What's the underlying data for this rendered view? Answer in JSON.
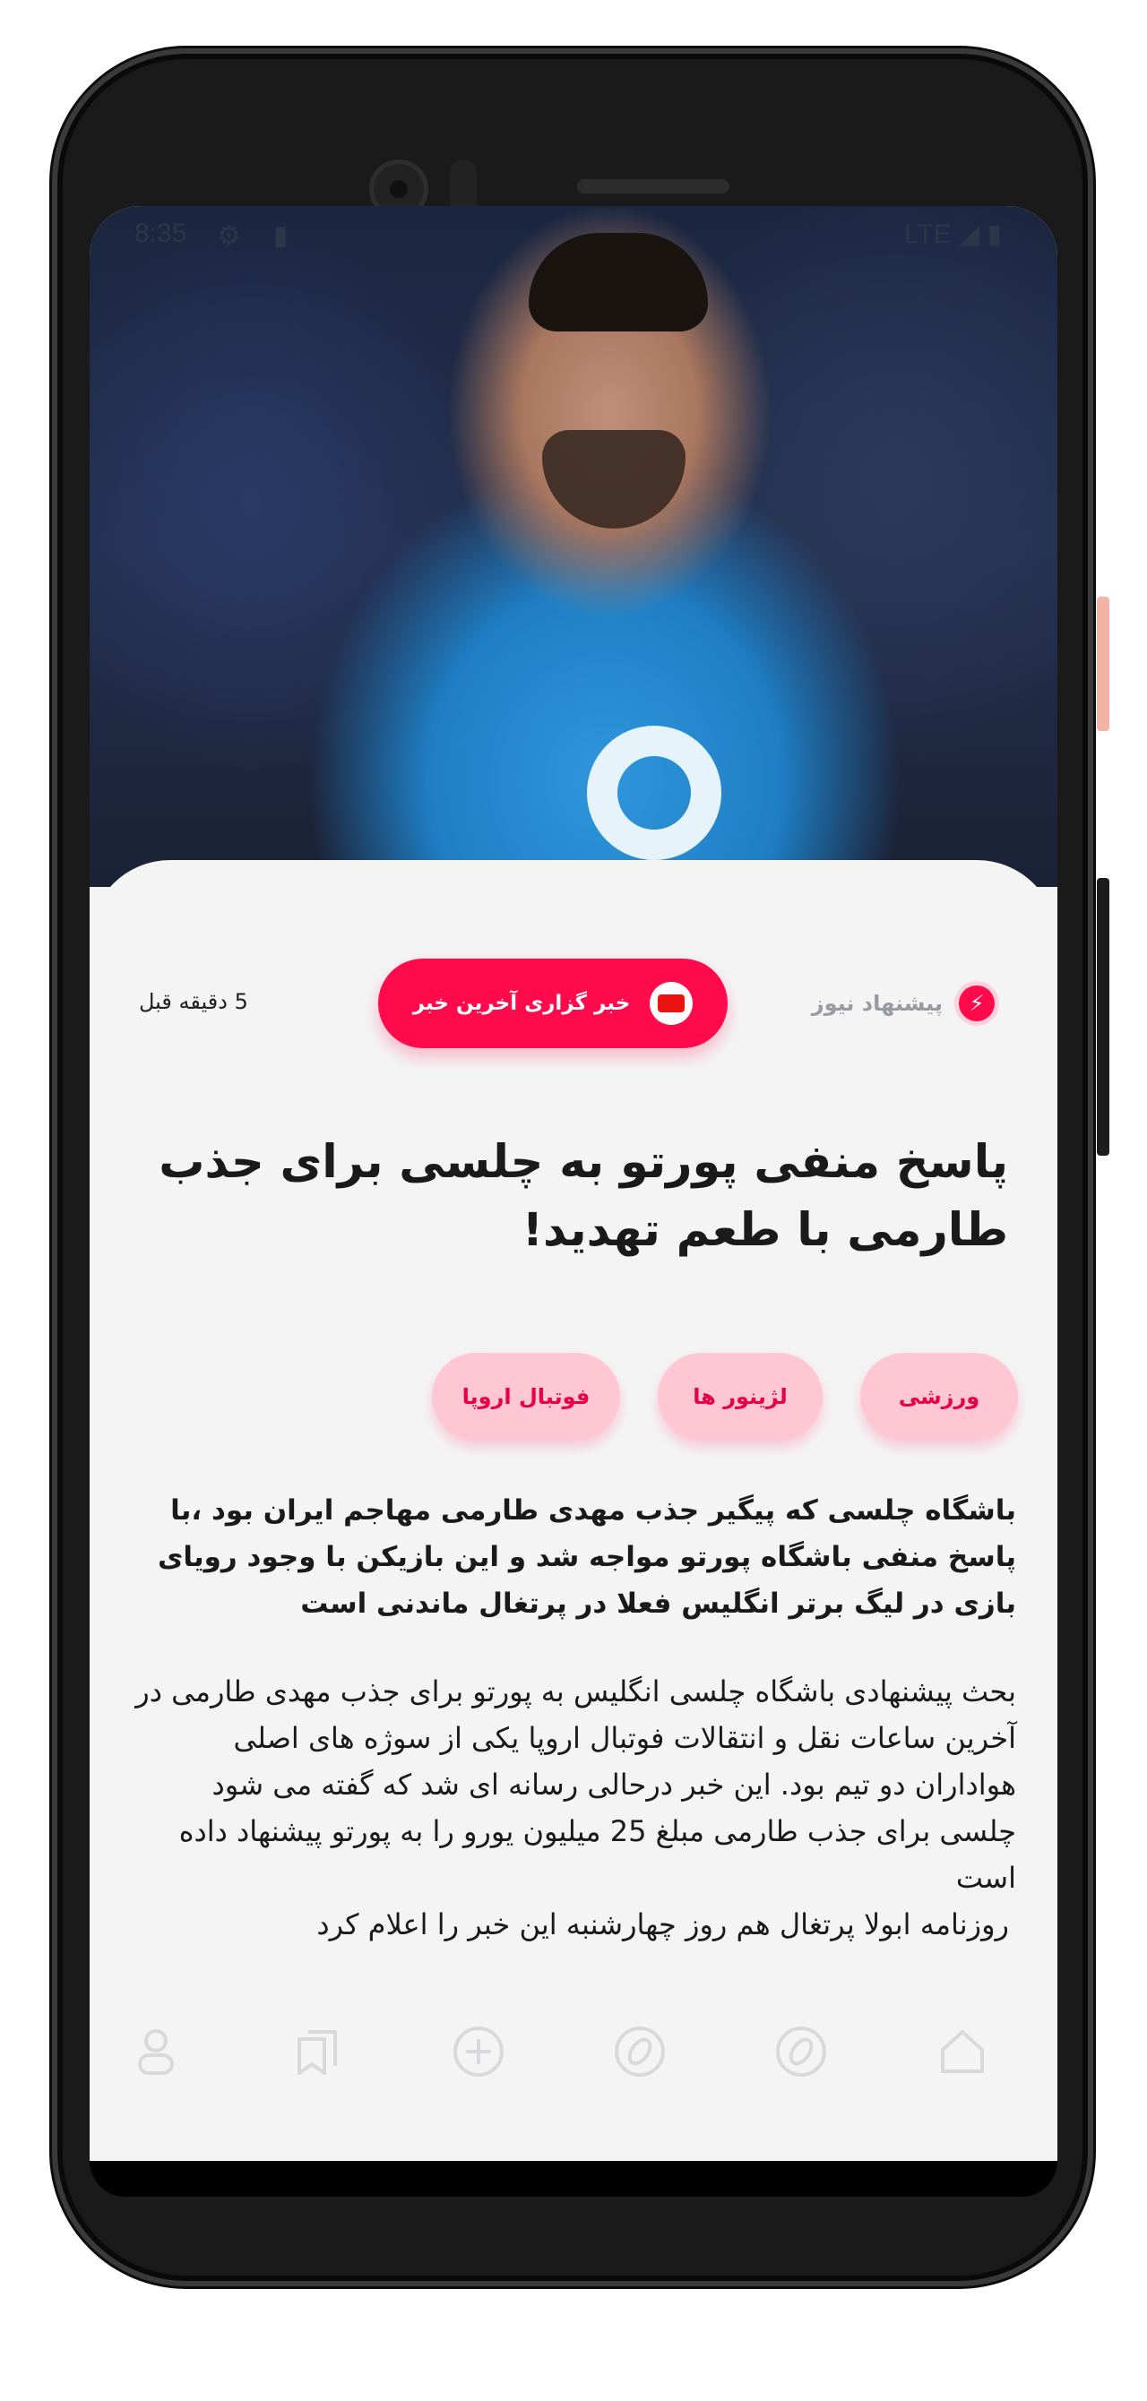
{
  "status_bar": {
    "time": "8:35",
    "network": "LTE"
  },
  "article": {
    "source_suggest_label": "پیشنهاد نیوز",
    "agency_name": "خبر گزاری آخرین خبر",
    "time_ago": "5 دقیقه قبل",
    "title": "پاسخ منفی پورتو به چلسی برای جذب طارمی با طعم تهدید!",
    "tags": [
      "ورزشی",
      "لژینور ها",
      "فوتبال اروپا"
    ],
    "lead": "باشگاه چلسی که پیگیر جذب مهدی طارمی مهاجم ایران بود ،با پاسخ منفی باشگاه پورتو مواجه شد و این بازیکن با وجود رویای بازی در لیگ برتر انگلیس فعلا در پرتغال ماندنی است",
    "body_p1": "بحث پیشنهادی باشگاه چلسی انگلیس به پورتو برای جذب مهدی طارمی در آخرین ساعات نقل و انتقالات فوتبال اروپا یکی از سوژه های اصلی هواداران دو تیم بود. این خبر درحالی رسانه ای شد که گفته می شود چلسی برای جذب طارمی مبلغ 25 میلیون یورو را به پورتو پیشنهاد داده است",
    "body_p2": "روزنامه ابولا پرتغال هم روز چهارشنبه این خبر را اعلام کرد"
  },
  "nav": {
    "icons": [
      "home-icon",
      "explore-icon",
      "compass-icon",
      "add-icon",
      "bookmark-icon",
      "profile-icon"
    ]
  },
  "colors": {
    "accent": "#ff0a4a",
    "tag_bg": "#ffc7d4",
    "panel_bg": "#f4f4f5"
  }
}
